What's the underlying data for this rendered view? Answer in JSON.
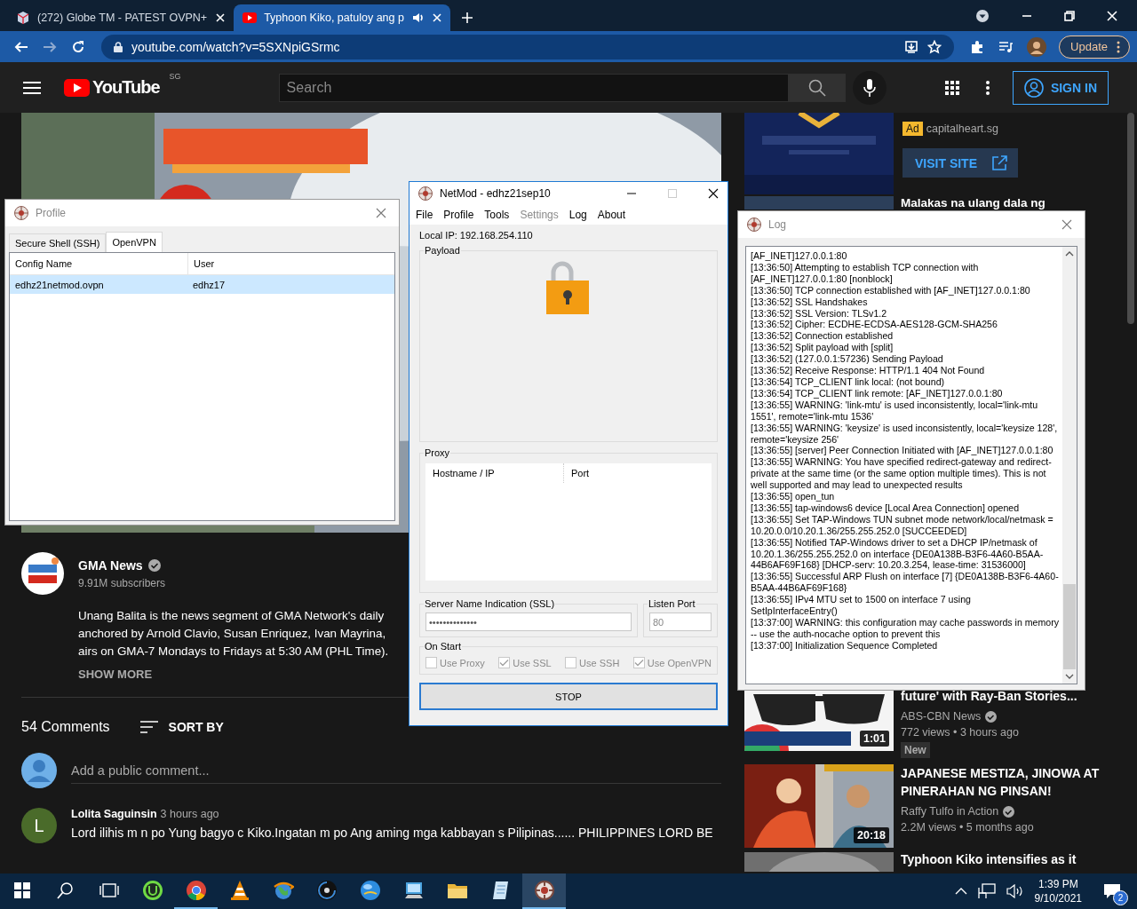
{
  "browser": {
    "tabs": [
      {
        "title": "(272) Globe TM - PATEST OVPN+",
        "kind": "box",
        "selected": false,
        "audio": false
      },
      {
        "title": "Typhoon Kiko, patuloy ang p",
        "kind": "video",
        "selected": true,
        "audio": true
      }
    ],
    "url": "youtube.com/watch?v=5SXNpiGSrmc",
    "update_label": "Update"
  },
  "youtube": {
    "logo": "YouTube",
    "region": "SG",
    "search_placeholder": "Search",
    "sign_in": "SIGN IN",
    "channel": {
      "name": "GMA News",
      "verified": true,
      "subscribers": "9.91M subscribers",
      "description": [
        "Unang Balita is the news segment of GMA Network's daily",
        "anchored by Arnold Clavio, Susan Enriquez, Ivan Mayrina,",
        "airs on GMA-7 Mondays to Fridays at 5:30 AM (PHL Time)."
      ],
      "show_more": "SHOW MORE"
    },
    "comments": {
      "count": "54 Comments",
      "sort": "SORT BY",
      "placeholder": "Add a public comment...",
      "items": [
        {
          "author": "Lolita Saguinsin",
          "time": "3 hours ago",
          "initial": "L",
          "color": "#4a6b2a",
          "text": "Lord ilihis m n po Yung bagyo c Kiko.Ingatan m po Ang aming mga kabbayan s Pilipinas...... PHILIPPINES LORD BE"
        }
      ]
    },
    "sidebar": {
      "ad": {
        "badge": "Ad",
        "domain": "capitalheart.sg",
        "button": "VISIT SITE"
      },
      "videos": [
        {
          "title": "Malakas na ulang dala ng"
        },
        {
          "title": "future' with Ray-Ban Stories...",
          "channel": "ABS-CBN News",
          "verified": true,
          "meta": "772 views • 3 hours ago",
          "badge": "New",
          "duration": "1:01"
        },
        {
          "title": "JAPANESE MESTIZA, JINOWA AT PINERAHAN NG PINSAN!",
          "channel": "Raffy Tulfo in Action",
          "verified": true,
          "meta": "2.2M views • 5 months ago",
          "duration": "20:18"
        },
        {
          "title": "Typhoon Kiko intensifies as it"
        }
      ]
    }
  },
  "profile_window": {
    "title": "Profile",
    "tabs": [
      {
        "label": "Secure Shell (SSH)",
        "selected": false
      },
      {
        "label": "OpenVPN",
        "selected": true
      }
    ],
    "columns": [
      "Config Name",
      "User"
    ],
    "rows": [
      {
        "cells": [
          "edhz21netmod.ovpn",
          "edhz17"
        ],
        "selected": true
      }
    ]
  },
  "netmod_window": {
    "title": "NetMod - edhz21sep10",
    "menu": [
      {
        "label": "File",
        "disabled": false
      },
      {
        "label": "Profile",
        "disabled": false
      },
      {
        "label": "Tools",
        "disabled": false
      },
      {
        "label": "Settings",
        "disabled": true
      },
      {
        "label": "Log",
        "disabled": false
      },
      {
        "label": "About",
        "disabled": false
      }
    ],
    "local_ip": "Local IP: 192.168.254.110",
    "payload_label": "Payload",
    "locked": true,
    "proxy": {
      "label": "Proxy",
      "columns": [
        "Hostname / IP",
        "Port"
      ]
    },
    "sni": {
      "label": "Server Name Indication (SSL)",
      "value": "••••••••••••••"
    },
    "listen_port": {
      "label": "Listen Port",
      "value": "80"
    },
    "on_start": {
      "label": "On Start",
      "options": [
        {
          "label": "Use Proxy",
          "checked": false,
          "disabled": true
        },
        {
          "label": "Use SSL",
          "checked": true,
          "disabled": true
        },
        {
          "label": "Use SSH",
          "checked": false,
          "disabled": true
        },
        {
          "label": "Use OpenVPN",
          "checked": true,
          "disabled": true
        }
      ]
    },
    "stop_button": "STOP"
  },
  "log_window": {
    "title": "Log",
    "lines": [
      "[AF_INET]127.0.0.1:80",
      "[13:36:50] Attempting to establish TCP connection with [AF_INET]127.0.0.1:80 [nonblock]",
      "[13:36:50] TCP connection established with [AF_INET]127.0.0.1:80",
      "[13:36:52] SSL Handshakes",
      "[13:36:52] SSL Version: TLSv1.2",
      "[13:36:52] Cipher: ECDHE-ECDSA-AES128-GCM-SHA256",
      "[13:36:52] Connection established",
      "[13:36:52] Split payload with [split]",
      "[13:36:52] (127.0.0.1:57236) Sending Payload",
      "[13:36:52] Receive Response: HTTP/1.1 404 Not Found",
      "[13:36:54] TCP_CLIENT link local: (not bound)",
      "[13:36:54] TCP_CLIENT link remote: [AF_INET]127.0.0.1:80",
      "[13:36:55] WARNING: 'link-mtu' is used inconsistently, local='link-mtu 1551', remote='link-mtu 1536'",
      "[13:36:55] WARNING: 'keysize' is used inconsistently, local='keysize 128', remote='keysize 256'",
      "[13:36:55] [server] Peer Connection Initiated with [AF_INET]127.0.0.1:80",
      "[13:36:55] WARNING: You have specified redirect-gateway and redirect-private at the same time (or the same option multiple times). This is not well supported and may lead to unexpected results",
      "[13:36:55] open_tun",
      "[13:36:55] tap-windows6 device [Local Area Connection] opened",
      "[13:36:55] Set TAP-Windows TUN subnet mode network/local/netmask = 10.20.0.0/10.20.1.36/255.255.252.0 [SUCCEEDED]",
      "[13:36:55] Notified TAP-Windows driver to set a DHCP IP/netmask of 10.20.1.36/255.255.252.0 on interface {DE0A138B-B3F6-4A60-B5AA-44B6AF69F168} [DHCP-serv: 10.20.3.254, lease-time: 31536000]",
      "[13:36:55] Successful ARP Flush on interface [7] {DE0A138B-B3F6-4A60-B5AA-44B6AF69F168}",
      "[13:36:55] IPv4 MTU set to 1500 on interface 7 using SetIpInterfaceEntry()",
      "[13:37:00] WARNING: this configuration may cache passwords in memory -- use the auth-nocache option to prevent this",
      "[13:37:00] Initialization Sequence Completed"
    ]
  },
  "taskbar": {
    "items": [
      {
        "kind": "start",
        "running": false,
        "selected": false
      },
      {
        "kind": "search",
        "running": false,
        "selected": false
      },
      {
        "kind": "task-view",
        "running": false,
        "selected": false
      },
      {
        "kind": "ring",
        "running": false,
        "selected": false
      },
      {
        "kind": "browser",
        "running": true,
        "selected": false
      },
      {
        "kind": "cone",
        "running": false,
        "selected": false
      },
      {
        "kind": "globe",
        "running": false,
        "selected": false
      },
      {
        "kind": "disc",
        "running": false,
        "selected": false
      },
      {
        "kind": "sphere",
        "running": false,
        "selected": false
      },
      {
        "kind": "computer",
        "running": false,
        "selected": false
      },
      {
        "kind": "folder",
        "running": false,
        "selected": false
      },
      {
        "kind": "notepad",
        "running": false,
        "selected": false
      },
      {
        "kind": "gear",
        "running": true,
        "selected": true
      }
    ],
    "time": "1:39 PM",
    "date": "9/10/2021",
    "notifications": "2"
  }
}
